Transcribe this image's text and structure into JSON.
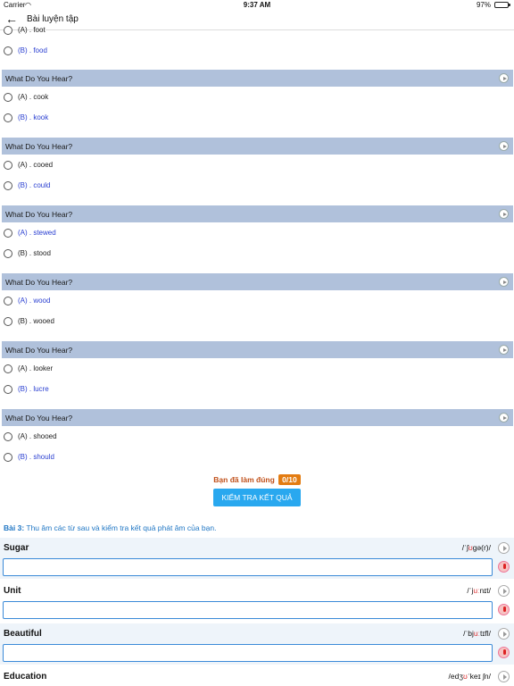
{
  "status": {
    "carrier": "Carrier",
    "wifi_icon": "wifi-icon",
    "time": "9:37 AM",
    "battery_pct": "97%"
  },
  "nav": {
    "title": "Bài luyện tập"
  },
  "first_option_partial": "(A) . foot",
  "first_option_b": "(B) . food",
  "questions": [
    {
      "title": "What Do You Hear?",
      "a": "(A) . cook",
      "b": "(B) . kook",
      "correct": "b"
    },
    {
      "title": "What Do You Hear?",
      "a": "(A) . cooed",
      "b": "(B) . could",
      "correct": "b"
    },
    {
      "title": "What Do You Hear?",
      "a": "(A) . stewed",
      "b": "(B) . stood",
      "correct": "a"
    },
    {
      "title": "What Do You Hear?",
      "a": "(A) . wood",
      "b": "(B) . wooed",
      "correct": "a"
    },
    {
      "title": "What Do You Hear?",
      "a": "(A) . looker",
      "b": "(B) . lucre",
      "correct": "b"
    },
    {
      "title": "What Do You Hear?",
      "a": "(A) . shooed",
      "b": "(B) . should",
      "correct": "b"
    }
  ],
  "result": {
    "label": "Bạn đã làm đúng",
    "score": "0/10",
    "check_button": "KIỂM TRA KẾT QUẢ"
  },
  "exercise3": {
    "label": "Bài 3:",
    "text": "Thu âm các từ sau và kiểm tra kết quả phát âm của bạn."
  },
  "words": [
    {
      "word": "Sugar",
      "ipa_pre": "/ˈʃ",
      "ipa_hl": "ʊ",
      "ipa_post": "ɡə(r)/",
      "answer": ""
    },
    {
      "word": "Unit",
      "ipa_pre": "/ˈj",
      "ipa_hl": "uː",
      "ipa_post": "nɪt/",
      "answer": ""
    },
    {
      "word": "Beautiful",
      "ipa_pre": "/ˈbj",
      "ipa_hl": "uː",
      "ipa_post": "tɪfl/",
      "answer": ""
    },
    {
      "word": "Education",
      "ipa_pre": "/edʒ",
      "ipa_hl": "ʊ",
      "ipa_post": "ˈkeɪ ʃn/",
      "answer": ""
    }
  ]
}
